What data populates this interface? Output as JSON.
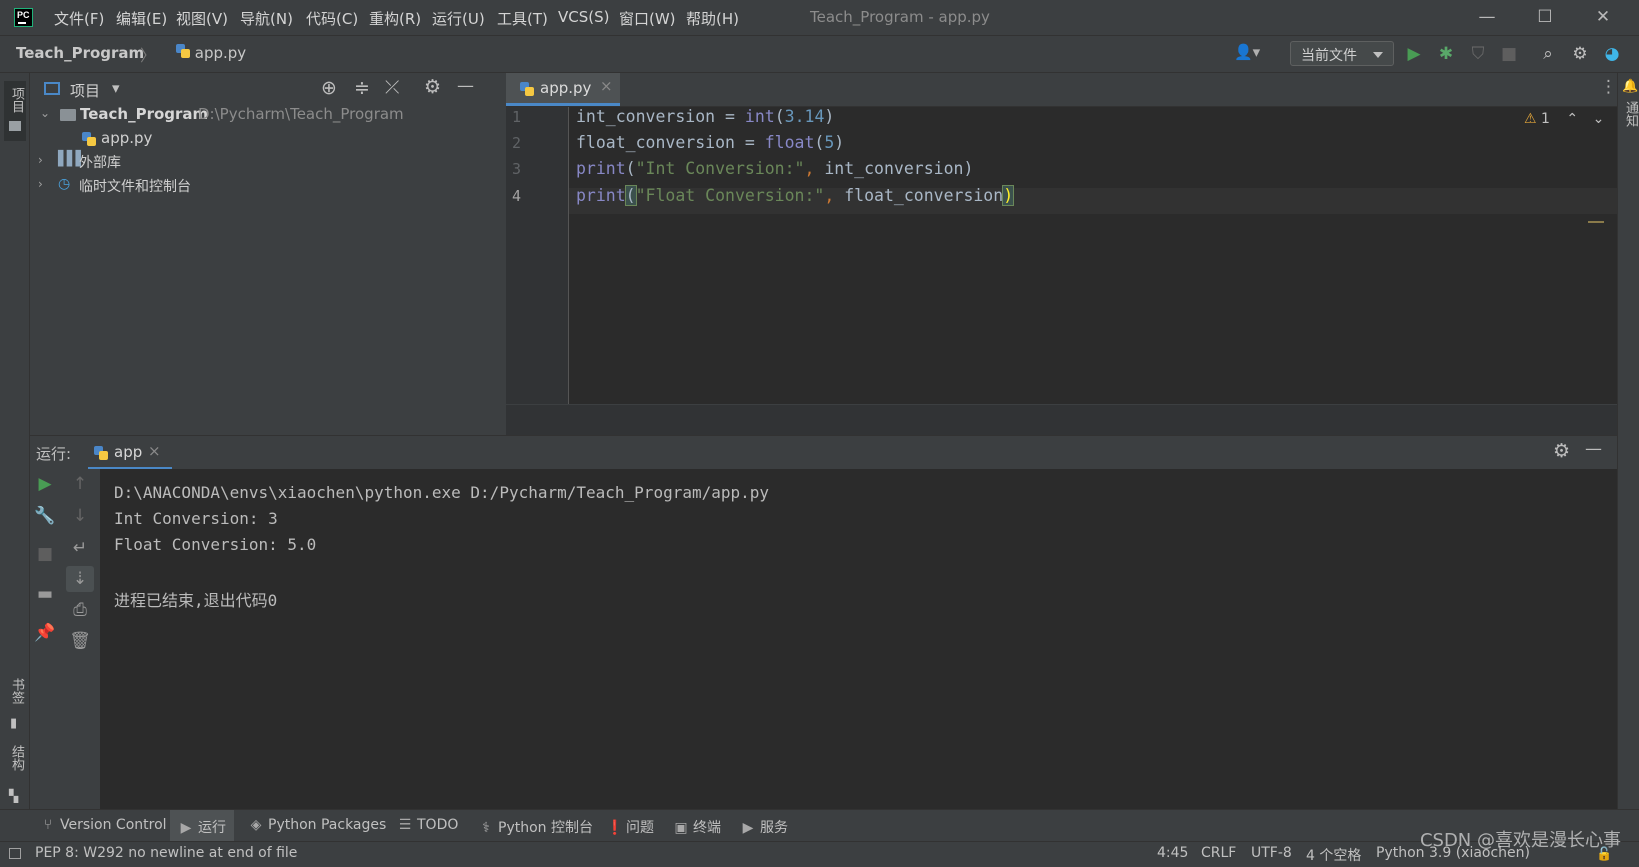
{
  "titlebar": {
    "logo_text": "PC",
    "menu": [
      "文件(F)",
      "编辑(E)",
      "视图(V)",
      "导航(N)",
      "代码(C)",
      "重构(R)",
      "运行(U)",
      "工具(T)",
      "VCS(S)",
      "窗口(W)",
      "帮助(H)"
    ],
    "window_title": "Teach_Program - app.py",
    "controls": {
      "minimize": "—",
      "maximize": "☐",
      "close": "✕"
    }
  },
  "navbar": {
    "project": "Teach_Program",
    "separator": "〉",
    "file": "app.py",
    "user_icon": "👤▾",
    "run_config": "当前文件",
    "icons": {
      "run": "▶",
      "debug": "✱",
      "coverage": "⛉",
      "stop": "■",
      "search": "⌕",
      "settings": "⚙",
      "logo": "◕"
    }
  },
  "left_strip": {
    "project_label": "项目",
    "bookmarks_label": "书签",
    "structure_label": "结构"
  },
  "right_strip": {
    "notifications_label": "通知",
    "bell": "🔔"
  },
  "project_panel": {
    "title": "项目",
    "dropdown": "▾",
    "header_icons": {
      "locate": "⊕",
      "expand": "≑",
      "collapse": "⤫",
      "settings": "⚙",
      "hide": "—"
    },
    "tree": {
      "root_name": "Teach_Program",
      "root_path": "D:\\Pycharm\\Teach_Program",
      "file": "app.py",
      "external_libs": "外部库",
      "scratches": "临时文件和控制台"
    }
  },
  "editor": {
    "tab_label": "app.py",
    "tab_close": "×",
    "more_icon": "⋮",
    "warnings": "1",
    "line_numbers": [
      "1",
      "2",
      "3",
      "4"
    ],
    "code": [
      [
        "int_conversion = ",
        "int",
        "(",
        "3.14",
        ")"
      ],
      [
        "float_conversion = ",
        "float",
        "(",
        "5",
        ")"
      ],
      [
        "print",
        "(",
        "\"Int Conversion:\"",
        ", ",
        "int_conversion",
        ")"
      ],
      [
        "print",
        "(",
        "\"Float Conversion:\"",
        ", ",
        "float_conversion",
        ")"
      ]
    ]
  },
  "run_panel": {
    "label": "运行:",
    "tab": "app",
    "tab_close": "×",
    "output": [
      "D:\\ANACONDA\\envs\\xiaochen\\python.exe D:/Pycharm/Teach_Program/app.py",
      "Int Conversion: 3",
      "Float Conversion: 5.0",
      "",
      "进程已结束,退出代码0"
    ]
  },
  "tool_tabs": [
    {
      "icon": "⑂",
      "label": "Version Control"
    },
    {
      "icon": "▶",
      "label": "运行"
    },
    {
      "icon": "◈",
      "label": "Python Packages"
    },
    {
      "icon": "☰",
      "label": "TODO"
    },
    {
      "icon": "⚕",
      "label": "Python 控制台"
    },
    {
      "icon": "❗",
      "label": "问题"
    },
    {
      "icon": "▣",
      "label": "终端"
    },
    {
      "icon": "▶",
      "label": "服务"
    }
  ],
  "statusbar": {
    "message": "PEP 8: W292 no newline at end of file",
    "position": "4:45",
    "line_sep": "CRLF",
    "encoding": "UTF-8",
    "indent": "4 个空格",
    "interpreter": "Python 3.9 (xiaochen)"
  },
  "watermark": "CSDN @喜欢是漫长心事",
  "colors": {
    "accent": "#4a88c7",
    "run_green": "#499c54",
    "keyword": "#8888c6",
    "string": "#6a8759",
    "number": "#6897bb"
  }
}
